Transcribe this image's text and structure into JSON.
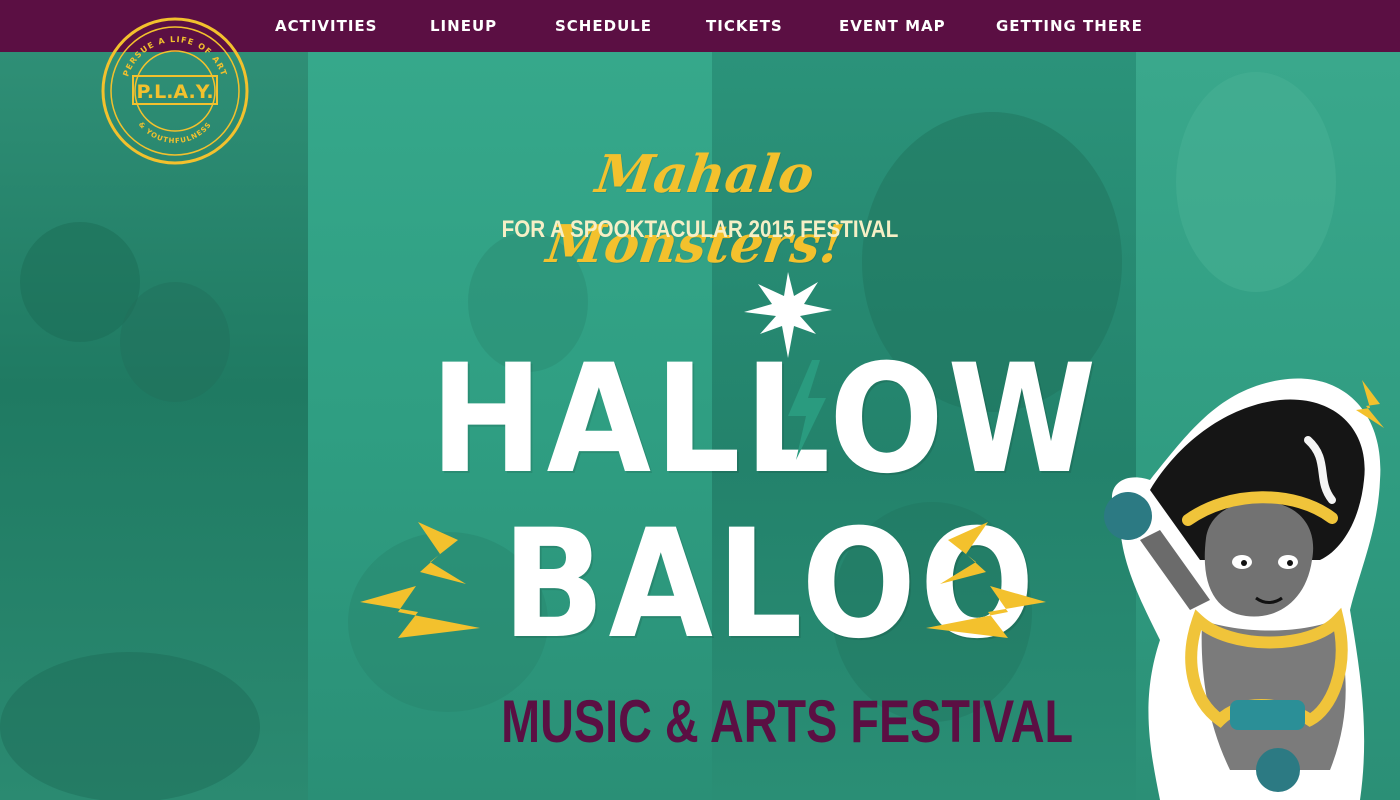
{
  "nav": {
    "items": [
      {
        "label": "ACTIVITIES"
      },
      {
        "label": "LINEUP"
      },
      {
        "label": "SCHEDULE"
      },
      {
        "label": "TICKETS"
      },
      {
        "label": "EVENT MAP"
      },
      {
        "label": "GETTING THERE"
      }
    ]
  },
  "badge": {
    "name": "P.L.A.Y.",
    "ring_text_top": "PERSUE A LIFE OF ART",
    "ring_text_bottom": "& YOUTHFULNESS"
  },
  "hero": {
    "tagline": "Mahalo Monsters!",
    "subtagline": "FOR A SPOOKTACULAR 2015 FESTIVAL",
    "logo_line_1": "HALLOW",
    "logo_line_2": "BALOO",
    "festival_title": "MUSIC & ARTS FESTIVAL"
  },
  "colors": {
    "nav_bg": "#5b0f43",
    "hero_bg": "#2a9b7f",
    "accent_yellow": "#f3c12d",
    "logo_white": "#ffffff",
    "festival_title": "#5b0f43"
  },
  "icons": {
    "pineapple": "pineapple-icon",
    "lightning": "lightning-bolt-icon"
  }
}
